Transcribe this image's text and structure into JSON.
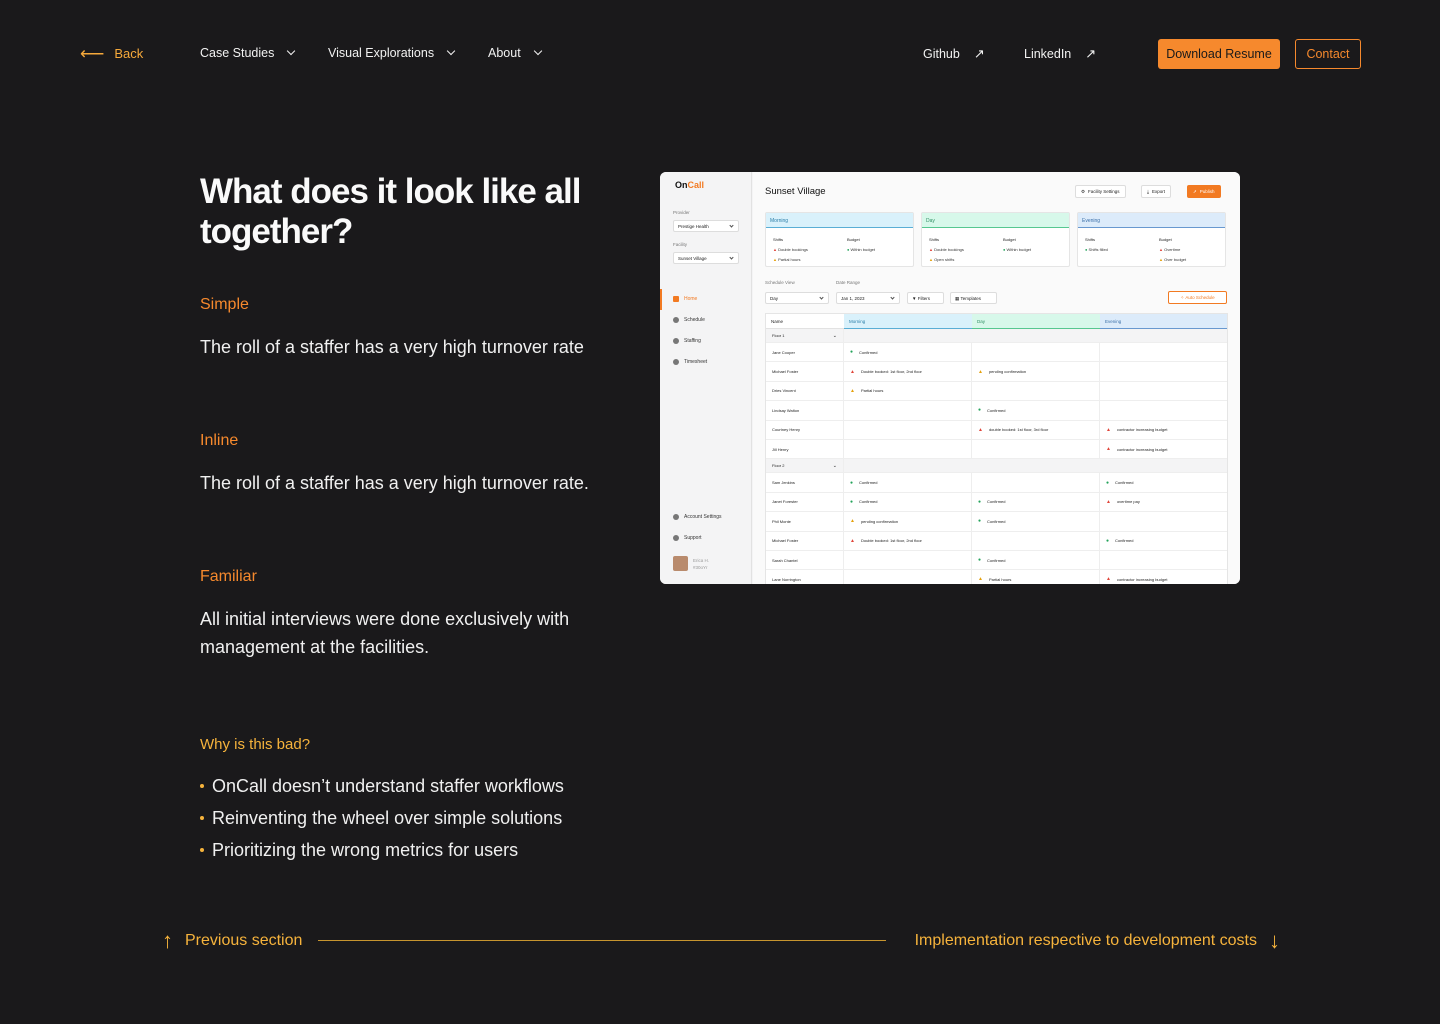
{
  "nav": {
    "back": "Back",
    "menu": [
      "Case Studies",
      "Visual Explorations",
      "About"
    ],
    "github": "Github",
    "linkedin": "LinkedIn",
    "download": "Download Resume",
    "contact": "Contact",
    "colors": {
      "accent": "#f6892d",
      "background": "#1a191b"
    }
  },
  "content": {
    "heading": "What does it look like all together?",
    "sections": [
      {
        "title": "Simple",
        "text": "The roll of a staffer has a very high turnover rate"
      },
      {
        "title": "Inline",
        "text": "The roll of a staffer has a very high turnover rate."
      },
      {
        "title": "Familiar",
        "text": "All initial interviews were done exclusively with management at the facilities."
      }
    ],
    "why_title": "Why is this bad?",
    "bullets": [
      "OnCall doesn’t understand staffer workflows",
      "Reinventing the wheel over simple solutions",
      "Prioritizing the wrong metrics for users"
    ]
  },
  "footer": {
    "prev": "Previous section",
    "next": "Implementation respective to development costs"
  },
  "app": {
    "logo_a": "On",
    "logo_b": "Call",
    "provider_label": "Provider",
    "provider": "Prestige Health",
    "facility_label": "Facility",
    "facility": "Sunset Village",
    "nav": [
      "Home",
      "Schedule",
      "Staffing",
      "Timesheet"
    ],
    "nav_bottom": [
      "Account Settings",
      "Support"
    ],
    "user_name": "Erica H.",
    "user_sub": "#30oYr",
    "title": "Sunset Village",
    "header_buttons": [
      "Facility Settings",
      "Export",
      "Publish"
    ],
    "cards": [
      {
        "name": "Morning",
        "shifts": [
          "Double bookings",
          "Partial hours"
        ],
        "budget": [
          "Within budget"
        ]
      },
      {
        "name": "Day",
        "shifts": [
          "Double bookings",
          "Open shifts"
        ],
        "budget": [
          "Within budget"
        ]
      },
      {
        "name": "Evening",
        "shifts": [
          "Shifts filled"
        ],
        "budget": [
          "Overtime",
          "Over budget"
        ]
      }
    ],
    "shifts_label": "Shifts",
    "budget_label": "Budget",
    "schedule_view_label": "Schedule View",
    "schedule_view": "Day",
    "date_range_label": "Date Range",
    "date_range": "Jan 1, 2023",
    "filters": "Filters",
    "templates": "Templates",
    "auto_schedule": "Auto Schedule",
    "table_headers": [
      "Name",
      "Morning",
      "Day",
      "Evening"
    ],
    "rows": [
      {
        "group": "Floor 1"
      },
      {
        "name": "Jane Cooper",
        "m": [
          "ok",
          "Confirmed"
        ],
        "d": null,
        "e": null
      },
      {
        "name": "Michael Foster",
        "m": [
          "err",
          "Double booked: 1st floor, 2nd floor"
        ],
        "d": [
          "warn",
          "pending confirmation"
        ],
        "e": null
      },
      {
        "name": "Dries Vincent",
        "m": [
          "warn",
          "Partial hours"
        ],
        "d": null,
        "e": null
      },
      {
        "name": "Lindsay Walton",
        "m": null,
        "d": [
          "ok",
          "Confirmed"
        ],
        "e": null
      },
      {
        "name": "Courtney Henry",
        "m": null,
        "d": [
          "err",
          "double booked: 1st floor, 3rd floor"
        ],
        "e": [
          "err",
          "contractor increasing budget"
        ]
      },
      {
        "name": "Jill Henry",
        "m": null,
        "d": null,
        "e": [
          "err",
          "contractor increasing budget"
        ]
      },
      {
        "group": "Floor 2"
      },
      {
        "name": "Sam Jenkins",
        "m": [
          "ok",
          "Confirmed"
        ],
        "d": null,
        "e": [
          "ok",
          "Confirmed"
        ]
      },
      {
        "name": "Janet Forester",
        "m": [
          "ok",
          "Confirmed"
        ],
        "d": [
          "ok",
          "Confirmed"
        ],
        "e": [
          "err",
          "overtime pay"
        ]
      },
      {
        "name": "Phil Monte",
        "m": [
          "warn",
          "pending confirmation"
        ],
        "d": [
          "ok",
          "Confirmed"
        ],
        "e": null
      },
      {
        "name": "Michael Foster",
        "m": [
          "err",
          "Double booked: 1st floor, 2nd floor"
        ],
        "d": null,
        "e": [
          "ok",
          "Confirmed"
        ]
      },
      {
        "name": "Sarah Chantel",
        "m": null,
        "d": [
          "ok",
          "Confirmed"
        ],
        "e": null
      },
      {
        "name": "Lane Norrington",
        "m": null,
        "d": [
          "warn",
          "Partial hours"
        ],
        "e": [
          "err",
          "contractor increasing budget"
        ]
      }
    ]
  }
}
